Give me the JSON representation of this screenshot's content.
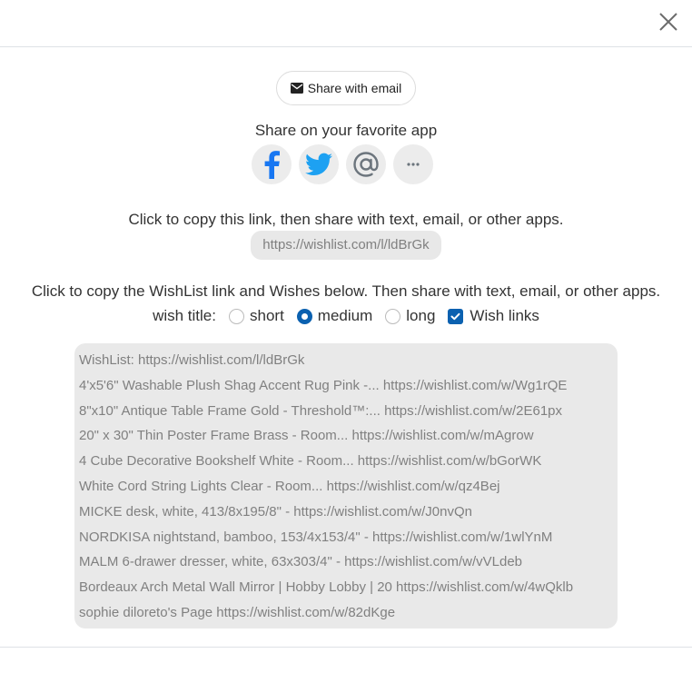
{
  "header": {
    "close_icon": "close-icon"
  },
  "share": {
    "email_button_label": "Share with email",
    "email_icon": "envelope-icon",
    "favorite_app_title": "Share on your favorite app",
    "apps": [
      {
        "name": "facebook",
        "icon": "facebook-icon",
        "color": "#1877f2"
      },
      {
        "name": "twitter",
        "icon": "twitter-icon",
        "color": "#1da1f2"
      },
      {
        "name": "email-at",
        "icon": "at-sign-icon",
        "color": "#6c757d"
      },
      {
        "name": "more",
        "icon": "more-icon",
        "color": "#6c757d"
      }
    ]
  },
  "copy_link": {
    "instruction": "Click to copy this link, then share with text, email, or other apps.",
    "link": "https://wishlist.com/l/ldBrGk"
  },
  "copy_wishes": {
    "instruction": "Click to copy the WishList link and Wishes below. Then share with text, email, or other apps.",
    "wish_title_label": "wish title:",
    "options": [
      {
        "label": "short",
        "selected": false
      },
      {
        "label": "medium",
        "selected": true
      },
      {
        "label": "long",
        "selected": false
      }
    ],
    "wish_links": {
      "label": "Wish links",
      "checked": true
    },
    "accent_color": "#0b61b0",
    "lines": [
      "WishList: https://wishlist.com/l/ldBrGk",
      "4'x5'6\" Washable Plush Shag Accent Rug Pink -... https://wishlist.com/w/Wg1rQE",
      "8\"x10\" Antique Table Frame Gold - Threshold™:... https://wishlist.com/w/2E61px",
      "20\" x 30\" Thin Poster Frame Brass - Room... https://wishlist.com/w/mAgrow",
      "4 Cube Decorative Bookshelf White - Room... https://wishlist.com/w/bGorWK",
      "White Cord String Lights Clear - Room... https://wishlist.com/w/qz4Bej",
      "MICKE desk, white, 413/8x195/8\" - https://wishlist.com/w/J0nvQn",
      "NORDKISA nightstand, bamboo, 153/4x153/4\" - https://wishlist.com/w/1wlYnM",
      "MALM 6-drawer dresser, white, 63x303/4\" - https://wishlist.com/w/vVLdeb",
      "Bordeaux Arch Metal Wall Mirror | Hobby Lobby | 20 https://wishlist.com/w/4wQklb",
      "sophie diloreto's Page https://wishlist.com/w/82dKge"
    ]
  }
}
